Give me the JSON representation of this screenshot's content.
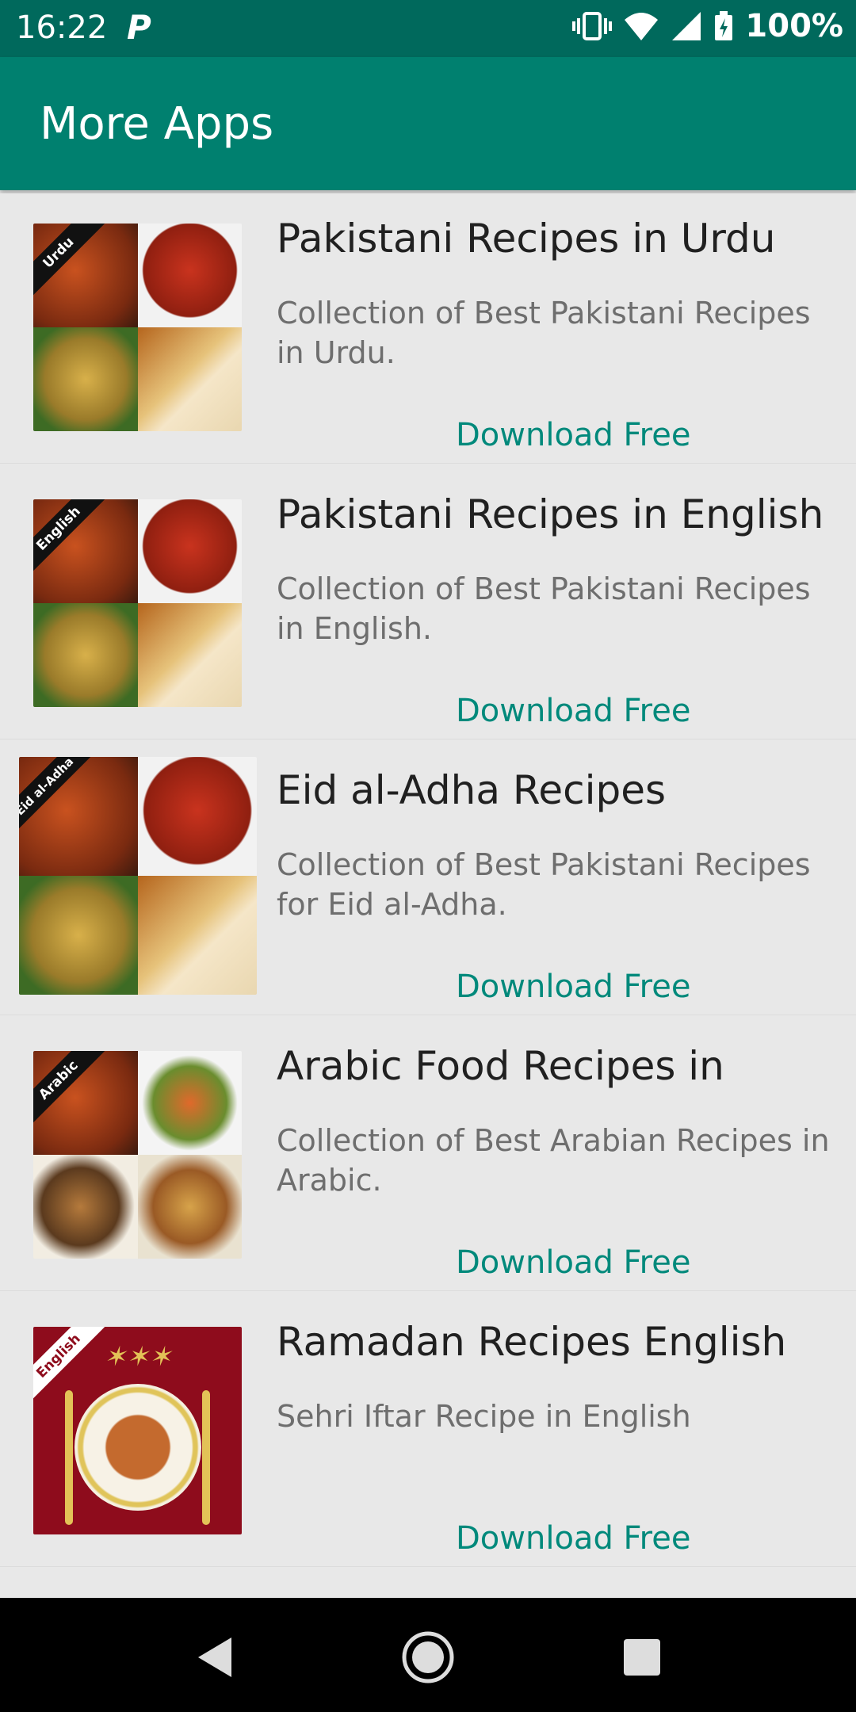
{
  "status_bar": {
    "time": "16:22",
    "battery": "100%",
    "icons": [
      "p-icon",
      "vibrate-icon",
      "wifi-icon",
      "signal-icon",
      "battery-icon"
    ]
  },
  "app_bar": {
    "title": "More Apps"
  },
  "apps": [
    {
      "title": "Pakistani Recipes in Urdu",
      "description": "Collection of Best Pakistani Recipes in Urdu.",
      "ribbon": "Urdu",
      "action": "Download Free"
    },
    {
      "title": "Pakistani Recipes in English",
      "description": "Collection of Best Pakistani Recipes in English.",
      "ribbon": "English",
      "action": "Download Free"
    },
    {
      "title": "Eid al-Adha Recipes",
      "description": "Collection of Best Pakistani Recipes for Eid al-Adha.",
      "ribbon": "Eid al-Adha",
      "action": "Download Free"
    },
    {
      "title": "Arabic Food Recipes in",
      "description": "Collection of Best Arabian Recipes in Arabic.",
      "ribbon": "Arabic",
      "action": "Download Free"
    },
    {
      "title": "Ramadan Recipes English",
      "description": "Sehri Iftar Recipe in English",
      "ribbon": "English",
      "action": "Download Free"
    }
  ],
  "nav_bar": {
    "icons": [
      "back-icon",
      "home-icon",
      "recents-icon"
    ]
  },
  "colors": {
    "status_bar": "#00695c",
    "app_bar": "#00806f",
    "accent": "#00897b",
    "background": "#e8e8e8"
  }
}
